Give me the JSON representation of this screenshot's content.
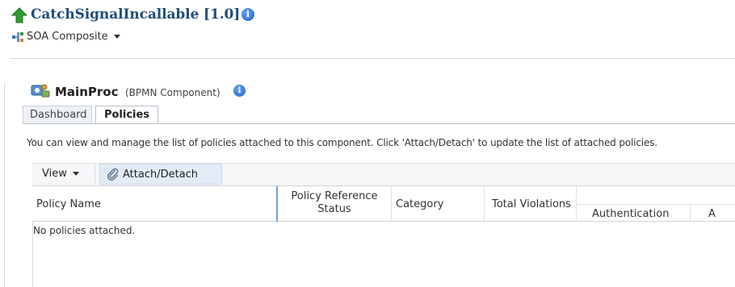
{
  "header": {
    "title": "CatchSignalIncallable [1.0]",
    "context_menu_label": "SOA Composite"
  },
  "component": {
    "name": "MainProc",
    "type": "(BPMN Component)"
  },
  "tabs": [
    {
      "label": "Dashboard",
      "active": false
    },
    {
      "label": "Policies",
      "active": true
    }
  ],
  "description": "You can view and manage the list of policies attached to this component. Click 'Attach/Detach' to update the list of attached policies.",
  "toolbar": {
    "view_label": "View",
    "attach_label": "Attach/Detach"
  },
  "table": {
    "columns": {
      "policy_name": "Policy Name",
      "policy_ref_status_1": "Policy Reference",
      "policy_ref_status_2": "Status",
      "category": "Category",
      "total_violations": "Total Violations",
      "authentication": "Authentication",
      "next_col_initial": "A"
    },
    "empty_message": "No policies attached."
  },
  "colors": {
    "title": "#1f4e79",
    "info_icon": "#1d5fc4",
    "up_arrow": "#2e9d2e",
    "active_column_divider": "#6fa3d6"
  },
  "icons": {
    "header_status": "green-up-arrow-icon",
    "info": "info-icon",
    "soa": "soa-composite-icon",
    "component": "bpmn-process-icon",
    "attach": "paperclip-icon"
  }
}
